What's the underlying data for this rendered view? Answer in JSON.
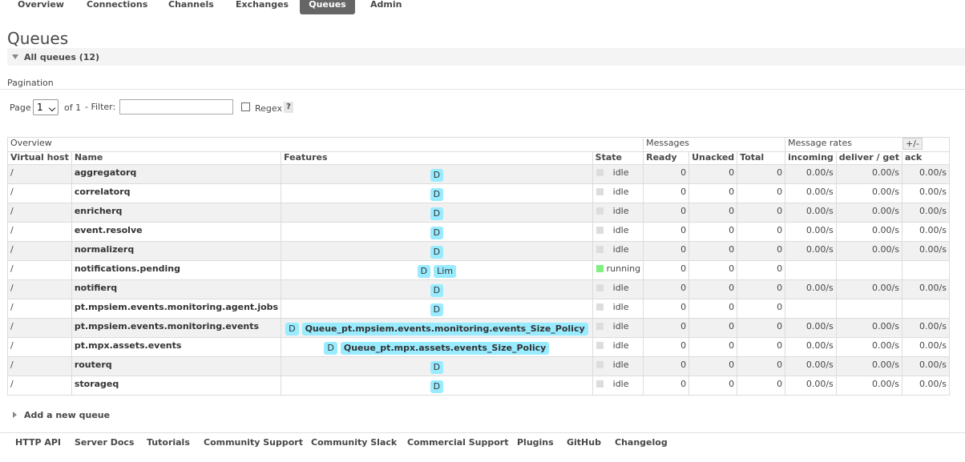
{
  "nav": {
    "tabs": [
      {
        "label": "Overview"
      },
      {
        "label": "Connections"
      },
      {
        "label": "Channels"
      },
      {
        "label": "Exchanges"
      },
      {
        "label": "Queues",
        "active": true
      },
      {
        "label": "Admin"
      }
    ]
  },
  "page": {
    "title": "Queues",
    "section_title": "All queues (12)"
  },
  "pagination": {
    "label": "Pagination",
    "page_label": "Page",
    "page_value": "1",
    "of_label": "of 1",
    "filter_label": "- Filter:",
    "filter_value": "",
    "regex_label": "Regex",
    "help_label": "?"
  },
  "table": {
    "groups": {
      "overview": "Overview",
      "messages": "Messages",
      "rates": "Message rates"
    },
    "columns": {
      "vhost": "Virtual host",
      "name": "Name",
      "features": "Features",
      "state": "State",
      "ready": "Ready",
      "unacked": "Unacked",
      "total": "Total",
      "incoming": "incoming",
      "deliver": "deliver / get",
      "ack": "ack"
    },
    "toggle_label": "+/-",
    "rows": [
      {
        "vhost": "/",
        "name": "aggregatorq",
        "features": [
          "D"
        ],
        "state": "idle",
        "ready": "0",
        "unacked": "0",
        "total": "0",
        "incoming": "0.00/s",
        "deliver": "0.00/s",
        "ack": "0.00/s"
      },
      {
        "vhost": "/",
        "name": "correlatorq",
        "features": [
          "D"
        ],
        "state": "idle",
        "ready": "0",
        "unacked": "0",
        "total": "0",
        "incoming": "0.00/s",
        "deliver": "0.00/s",
        "ack": "0.00/s"
      },
      {
        "vhost": "/",
        "name": "enricherq",
        "features": [
          "D"
        ],
        "state": "idle",
        "ready": "0",
        "unacked": "0",
        "total": "0",
        "incoming": "0.00/s",
        "deliver": "0.00/s",
        "ack": "0.00/s"
      },
      {
        "vhost": "/",
        "name": "event.resolve",
        "features": [
          "D"
        ],
        "state": "idle",
        "ready": "0",
        "unacked": "0",
        "total": "0",
        "incoming": "0.00/s",
        "deliver": "0.00/s",
        "ack": "0.00/s"
      },
      {
        "vhost": "/",
        "name": "normalizerq",
        "features": [
          "D"
        ],
        "state": "idle",
        "ready": "0",
        "unacked": "0",
        "total": "0",
        "incoming": "0.00/s",
        "deliver": "0.00/s",
        "ack": "0.00/s"
      },
      {
        "vhost": "/",
        "name": "notifications.pending",
        "features": [
          "D",
          "Lim"
        ],
        "state": "running",
        "ready": "0",
        "unacked": "0",
        "total": "0",
        "incoming": "",
        "deliver": "",
        "ack": ""
      },
      {
        "vhost": "/",
        "name": "notifierq",
        "features": [
          "D"
        ],
        "state": "idle",
        "ready": "0",
        "unacked": "0",
        "total": "0",
        "incoming": "0.00/s",
        "deliver": "0.00/s",
        "ack": "0.00/s"
      },
      {
        "vhost": "/",
        "name": "pt.mpsiem.events.monitoring.agent.jobs",
        "features": [
          "D"
        ],
        "state": "idle",
        "ready": "0",
        "unacked": "0",
        "total": "0",
        "incoming": "",
        "deliver": "",
        "ack": ""
      },
      {
        "vhost": "/",
        "name": "pt.mpsiem.events.monitoring.events",
        "features": [
          "D"
        ],
        "policy": "Queue_pt.mpsiem.events.monitoring.events_Size_Policy",
        "state": "idle",
        "ready": "0",
        "unacked": "0",
        "total": "0",
        "incoming": "0.00/s",
        "deliver": "0.00/s",
        "ack": "0.00/s"
      },
      {
        "vhost": "/",
        "name": "pt.mpx.assets.events",
        "features": [
          "D"
        ],
        "policy": "Queue_pt.mpx.assets.events_Size_Policy",
        "state": "idle",
        "ready": "0",
        "unacked": "0",
        "total": "0",
        "incoming": "0.00/s",
        "deliver": "0.00/s",
        "ack": "0.00/s"
      },
      {
        "vhost": "/",
        "name": "routerq",
        "features": [
          "D"
        ],
        "state": "idle",
        "ready": "0",
        "unacked": "0",
        "total": "0",
        "incoming": "0.00/s",
        "deliver": "0.00/s",
        "ack": "0.00/s"
      },
      {
        "vhost": "/",
        "name": "storageq",
        "features": [
          "D"
        ],
        "state": "idle",
        "ready": "0",
        "unacked": "0",
        "total": "0",
        "incoming": "0.00/s",
        "deliver": "0.00/s",
        "ack": "0.00/s"
      }
    ]
  },
  "add_queue": {
    "label": "Add a new queue"
  },
  "footer": {
    "links": [
      {
        "label": "HTTP API"
      },
      {
        "label": "Server Docs"
      },
      {
        "label": "Tutorials"
      },
      {
        "label": "Community Support"
      },
      {
        "label": "Community Slack"
      },
      {
        "label": "Commercial Support"
      },
      {
        "label": "Plugins"
      },
      {
        "label": "GitHub"
      },
      {
        "label": "Changelog"
      }
    ]
  }
}
